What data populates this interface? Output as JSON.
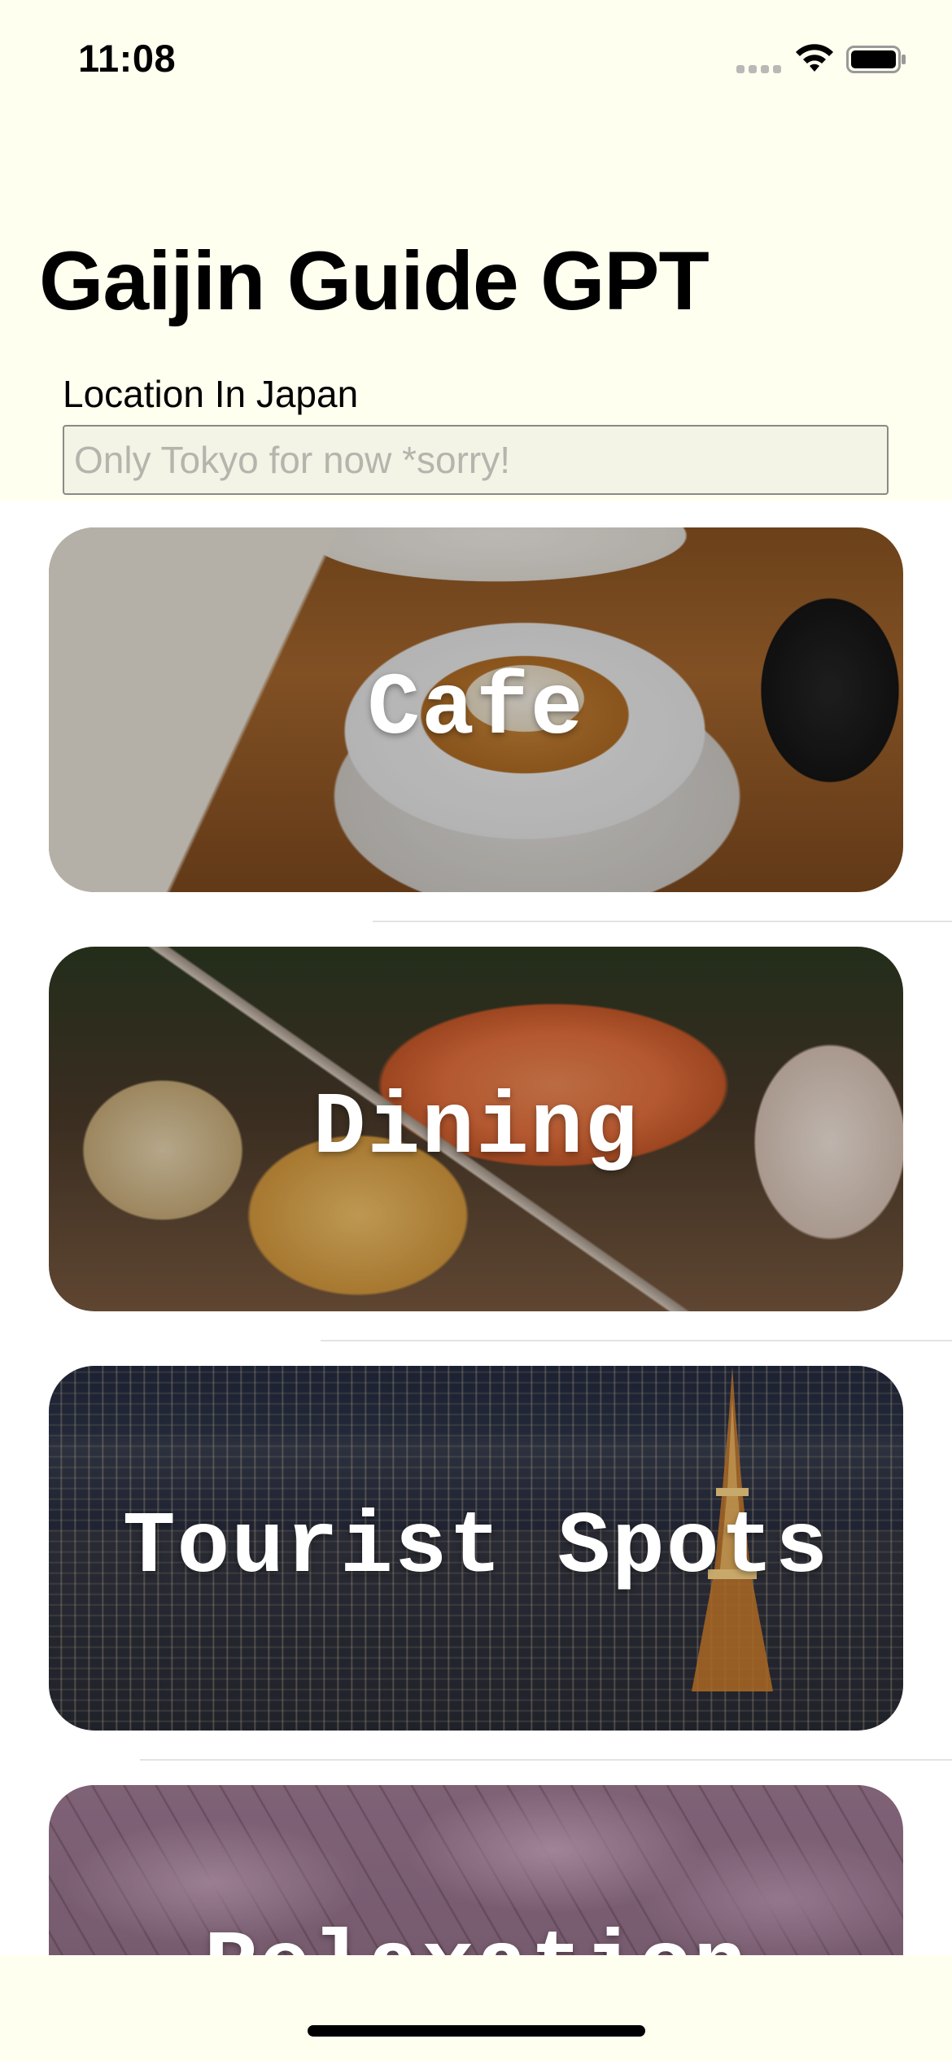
{
  "status_bar": {
    "time": "11:08",
    "signal_icon": "signal-dots-icon",
    "wifi_icon": "wifi-icon",
    "battery_icon": "battery-icon"
  },
  "header": {
    "title": "Gaijin Guide GPT"
  },
  "location": {
    "label": "Location In Japan",
    "value": "",
    "placeholder": "Only Tokyo for now *sorry!"
  },
  "categories": [
    {
      "label": "Cafe",
      "image": "latte-art-photo"
    },
    {
      "label": "Dining",
      "image": "salmon-sushi-photo"
    },
    {
      "label": "Tourist Spots",
      "image": "tokyo-tower-night-photo"
    },
    {
      "label": "Relaxation",
      "image": "cherry-blossom-photo"
    }
  ],
  "colors": {
    "background": "#fffff0",
    "list_background": "#ffffff",
    "input_background": "#f3f3e6",
    "title_text": "#000000",
    "card_text": "#ffffff"
  }
}
